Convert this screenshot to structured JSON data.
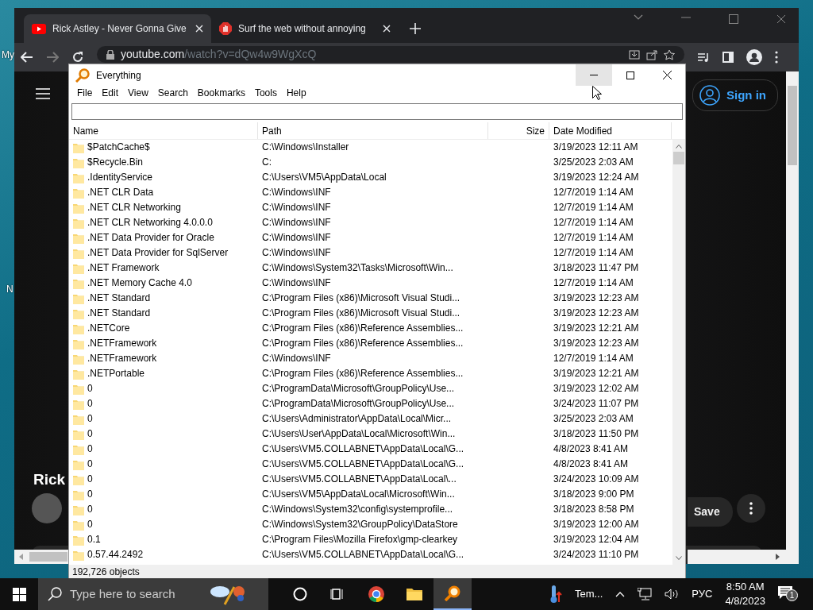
{
  "desktop": {
    "icon_labels": [
      "My",
      "N"
    ]
  },
  "browser": {
    "tabs": [
      {
        "kind": "video",
        "title": "Rick Astley - Never Gonna Give",
        "selected": true
      },
      {
        "kind": "stop",
        "title": "Surf the web without annoying",
        "selected": false
      }
    ],
    "address": {
      "domain": "youtube.com",
      "path": "/watch?v=dQw4w9WgXcQ"
    },
    "page": {
      "sign_in": "Sign in",
      "video_title": "Rick",
      "save": "Save"
    }
  },
  "everything": {
    "title": "Everything",
    "menu": [
      "File",
      "Edit",
      "View",
      "Search",
      "Bookmarks",
      "Tools",
      "Help"
    ],
    "columns": [
      "Name",
      "Path",
      "Size",
      "Date Modified"
    ],
    "rows": [
      {
        "name": "$PatchCache$",
        "path": "C:\\Windows\\Installer",
        "date": "3/19/2023 12:11 AM"
      },
      {
        "name": "$Recycle.Bin",
        "path": "C:",
        "date": "3/25/2023 2:03 AM"
      },
      {
        "name": ".IdentityService",
        "path": "C:\\Users\\VM5\\AppData\\Local",
        "date": "3/19/2023 12:24 AM"
      },
      {
        "name": ".NET CLR Data",
        "path": "C:\\Windows\\INF",
        "date": "12/7/2019 1:14 AM"
      },
      {
        "name": ".NET CLR Networking",
        "path": "C:\\Windows\\INF",
        "date": "12/7/2019 1:14 AM"
      },
      {
        "name": ".NET CLR Networking 4.0.0.0",
        "path": "C:\\Windows\\INF",
        "date": "12/7/2019 1:14 AM"
      },
      {
        "name": ".NET Data Provider for Oracle",
        "path": "C:\\Windows\\INF",
        "date": "12/7/2019 1:14 AM"
      },
      {
        "name": ".NET Data Provider for SqlServer",
        "path": "C:\\Windows\\INF",
        "date": "12/7/2019 1:14 AM"
      },
      {
        "name": ".NET Framework",
        "path": "C:\\Windows\\System32\\Tasks\\Microsoft\\Win...",
        "date": "3/18/2023 11:47 PM"
      },
      {
        "name": ".NET Memory Cache 4.0",
        "path": "C:\\Windows\\INF",
        "date": "12/7/2019 1:14 AM"
      },
      {
        "name": ".NET Standard",
        "path": "C:\\Program Files (x86)\\Microsoft Visual Studi...",
        "date": "3/19/2023 12:23 AM"
      },
      {
        "name": ".NET Standard",
        "path": "C:\\Program Files (x86)\\Microsoft Visual Studi...",
        "date": "3/19/2023 12:23 AM"
      },
      {
        "name": ".NETCore",
        "path": "C:\\Program Files (x86)\\Reference Assemblies...",
        "date": "3/19/2023 12:21 AM"
      },
      {
        "name": ".NETFramework",
        "path": "C:\\Program Files (x86)\\Reference Assemblies...",
        "date": "3/19/2023 12:23 AM"
      },
      {
        "name": ".NETFramework",
        "path": "C:\\Windows\\INF",
        "date": "12/7/2019 1:14 AM"
      },
      {
        "name": ".NETPortable",
        "path": "C:\\Program Files (x86)\\Reference Assemblies...",
        "date": "3/19/2023 12:21 AM"
      },
      {
        "name": "0",
        "path": "C:\\ProgramData\\Microsoft\\GroupPolicy\\Use...",
        "date": "3/19/2023 12:02 AM"
      },
      {
        "name": "0",
        "path": "C:\\ProgramData\\Microsoft\\GroupPolicy\\Use...",
        "date": "3/24/2023 11:07 PM"
      },
      {
        "name": "0",
        "path": "C:\\Users\\Administrator\\AppData\\Local\\Micr...",
        "date": "3/25/2023 2:03 AM"
      },
      {
        "name": "0",
        "path": "C:\\Users\\User\\AppData\\Local\\Microsoft\\Win...",
        "date": "3/18/2023 11:50 PM"
      },
      {
        "name": "0",
        "path": "C:\\Users\\VM5.COLLABNET\\AppData\\Local\\G...",
        "date": "4/8/2023 8:41 AM"
      },
      {
        "name": "0",
        "path": "C:\\Users\\VM5.COLLABNET\\AppData\\Local\\G...",
        "date": "4/8/2023 8:41 AM"
      },
      {
        "name": "0",
        "path": "C:\\Users\\VM5.COLLABNET\\AppData\\Local\\...",
        "date": "3/24/2023 10:09 AM"
      },
      {
        "name": "0",
        "path": "C:\\Users\\VM5\\AppData\\Local\\Microsoft\\Win...",
        "date": "3/18/2023 9:00 PM"
      },
      {
        "name": "0",
        "path": "C:\\Windows\\System32\\config\\systemprofile...",
        "date": "3/18/2023 8:58 PM"
      },
      {
        "name": "0",
        "path": "C:\\Windows\\System32\\GroupPolicy\\DataStore",
        "date": "3/19/2023 12:00 AM"
      },
      {
        "name": "0.1",
        "path": "C:\\Program Files\\Mozilla Firefox\\gmp-clearkey",
        "date": "3/19/2023 12:04 AM"
      },
      {
        "name": "0.57.44.2492",
        "path": "C:\\Users\\VM5.COLLABNET\\AppData\\Local\\G...",
        "date": "3/24/2023 11:10 PM"
      }
    ],
    "status": "192,726 objects"
  },
  "taskbar": {
    "search_placeholder": "Type here to search",
    "apps": [
      {
        "kind": "cortana",
        "selected": false
      },
      {
        "kind": "taskview",
        "selected": false
      },
      {
        "kind": "chrome",
        "selected": false
      },
      {
        "kind": "explorer",
        "selected": false
      },
      {
        "kind": "everything",
        "selected": true
      }
    ],
    "tray": {
      "widget": "Tem...",
      "language": "РУС",
      "time": "8:50 AM",
      "date": "4/8/2023",
      "notifications": "1"
    }
  }
}
